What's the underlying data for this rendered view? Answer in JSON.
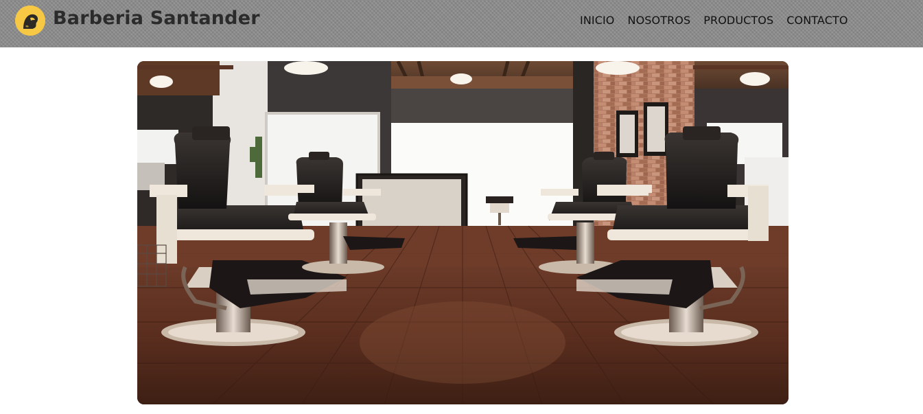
{
  "header": {
    "brand_name": "Barberia Santander",
    "logo_icon": "barber-silhouette-icon",
    "accent_color": "#f6c844",
    "bar_color": "#8a8a8a"
  },
  "nav": {
    "items": [
      {
        "label": "INICIO"
      },
      {
        "label": "NOSOTROS"
      },
      {
        "label": "PRODUCTOS"
      },
      {
        "label": "CONTACTO"
      }
    ]
  },
  "hero": {
    "image_subject": "barbershop-interior-with-vintage-barber-chairs"
  }
}
